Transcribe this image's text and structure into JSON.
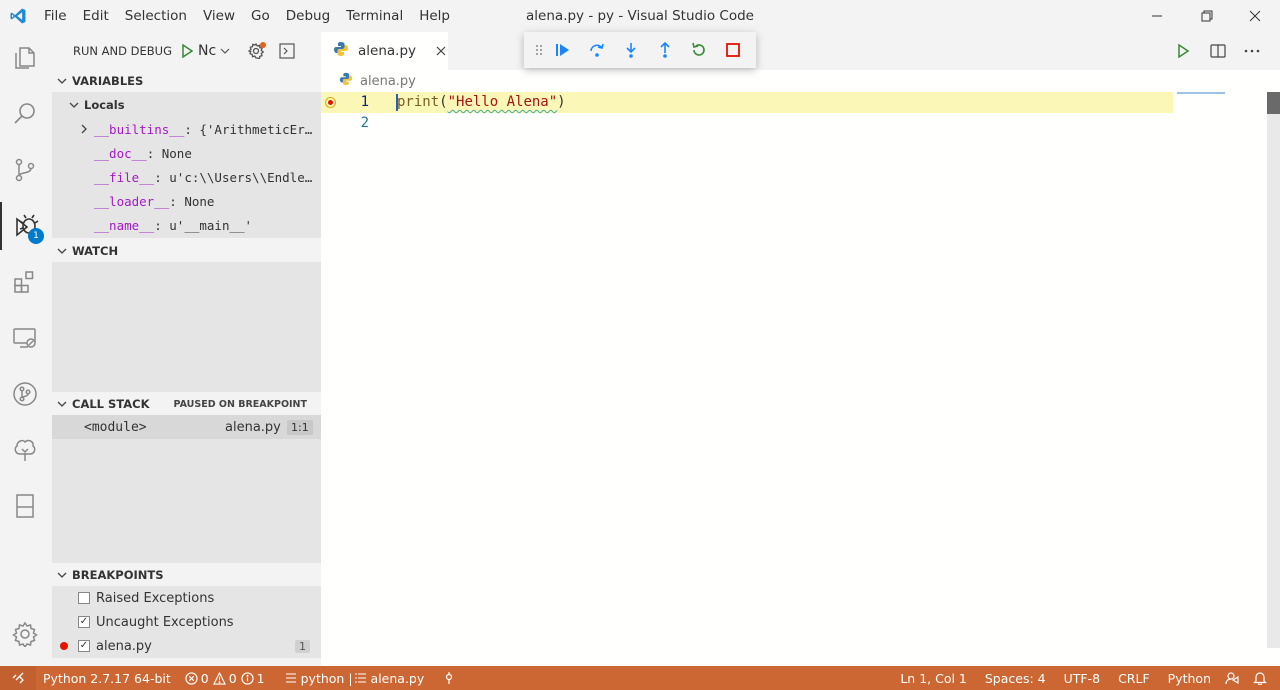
{
  "window": {
    "title": "alena.py - py - Visual Studio Code",
    "menu": [
      "File",
      "Edit",
      "Selection",
      "View",
      "Go",
      "Debug",
      "Terminal",
      "Help"
    ]
  },
  "activity_bar": {
    "items": [
      "explorer-icon",
      "search-icon",
      "source-control-icon",
      "run-debug-icon",
      "extensions-icon",
      "remote-explorer-icon",
      "git-graph-icon",
      "testing-tree-icon",
      "bookmark-icon",
      "settings-gear-icon"
    ],
    "debug_badge": "1"
  },
  "sidebar": {
    "run_and_debug_label": "RUN AND DEBUG",
    "config_select": "Nc",
    "variables": {
      "header": "VARIABLES",
      "scope": "Locals",
      "items": [
        {
          "name": "__builtins__",
          "value": ": {'ArithmeticEr…"
        },
        {
          "name": "__doc__",
          "value": ": None"
        },
        {
          "name": "__file__",
          "value": ": u'c:\\\\Users\\\\Endle…"
        },
        {
          "name": "__loader__",
          "value": ": None"
        },
        {
          "name": "__name__",
          "value": ": u'__main__'"
        }
      ]
    },
    "watch": {
      "header": "WATCH"
    },
    "call_stack": {
      "header": "CALL STACK",
      "status": "PAUSED ON BREAKPOINT",
      "frames": [
        {
          "name": "<module>",
          "file": "alena.py",
          "position": "1:1"
        }
      ]
    },
    "breakpoints": {
      "header": "BREAKPOINTS",
      "items": [
        {
          "label": "Raised Exceptions",
          "checked": false
        },
        {
          "label": "Uncaught Exceptions",
          "checked": true
        },
        {
          "label": "alena.py",
          "checked": true,
          "count": "1"
        }
      ]
    }
  },
  "editor": {
    "tab_label": "alena.py",
    "breadcrumb": "alena.py",
    "lines": [
      {
        "num": "1",
        "func": "print",
        "open": "(",
        "string": "\"Hello Alena\"",
        "close": ")"
      },
      {
        "num": "2"
      }
    ]
  },
  "statusbar": {
    "interpreter": "Python 2.7.17 64-bit",
    "errors": "0",
    "warnings": "0",
    "info": "1",
    "debug_config": "python | ",
    "debug_file": "alena.py",
    "cursor": "Ln 1, Col 1",
    "spaces": "Spaces: 4",
    "encoding": "UTF-8",
    "eol": "CRLF",
    "language": "Python"
  },
  "colors": {
    "accent": "#007acc",
    "statusbar_debug": "#cc6633",
    "current_line": "#fbf7b6",
    "variable_name": "#a31ac7",
    "string": "#a31515",
    "continue": "#1a85ff",
    "restart": "#388a34",
    "stop": "#e51400"
  }
}
